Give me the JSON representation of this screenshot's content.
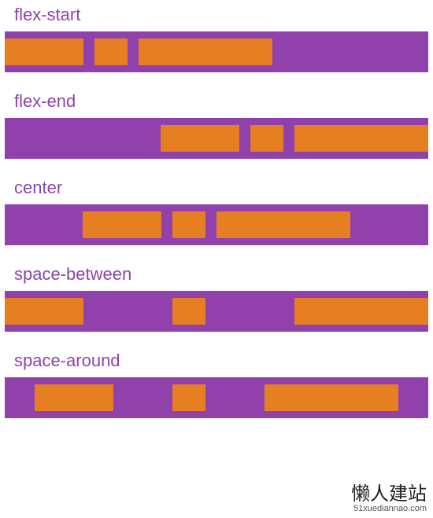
{
  "colors": {
    "container": "#9141AC",
    "item": "#E67E22",
    "label": "#8E44AD"
  },
  "box_widths": [
    100,
    42,
    170
  ],
  "sections": [
    {
      "label": "flex-start",
      "justify": "flex-start"
    },
    {
      "label": "flex-end",
      "justify": "flex-end"
    },
    {
      "label": "center",
      "justify": "center"
    },
    {
      "label": "space-between",
      "justify": "space-between"
    },
    {
      "label": "space-around",
      "justify": "space-around"
    }
  ],
  "watermark": {
    "title": "懒人建站",
    "url": "51xuediannao.com"
  }
}
